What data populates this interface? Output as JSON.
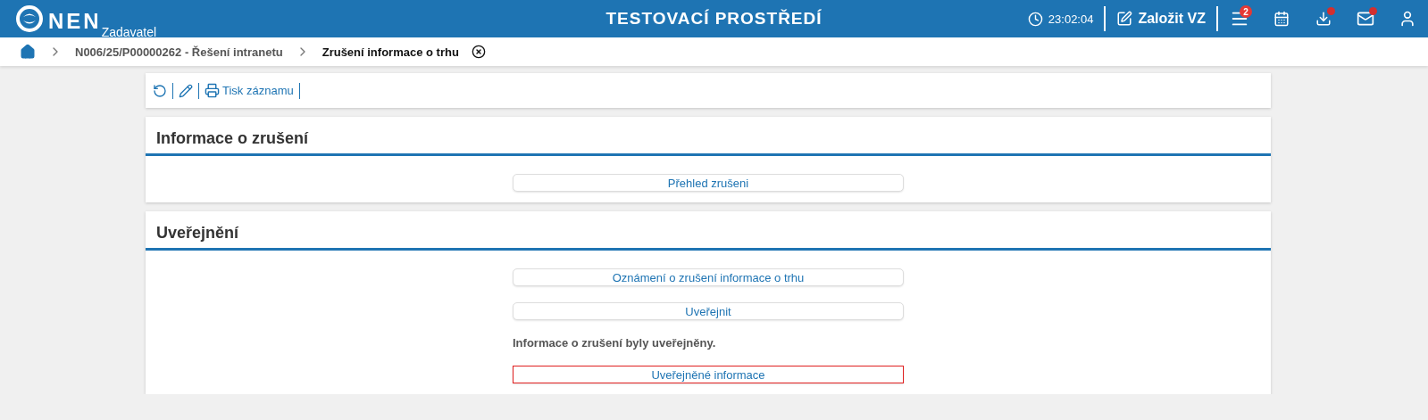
{
  "header": {
    "logo": "NEN",
    "role": "Zadavatel",
    "environment": "TESTOVACÍ PROSTŘEDÍ",
    "time": "23:02:04",
    "create_button": "Založit VZ",
    "menu_badge": "2",
    "download_alert": true,
    "mail_alert": true
  },
  "breadcrumb": [
    "N006/25/P00000262 - Řešení intranetu",
    "Zrušení informace o trhu"
  ],
  "toolbar": {
    "print_label": "Tisk záznamu"
  },
  "sections": [
    {
      "title": "Informace o zrušení",
      "items": [
        {
          "kind": "button",
          "label": "Přehled zrušeni",
          "focused": false
        }
      ]
    },
    {
      "title": "Uveřejnění",
      "items": [
        {
          "kind": "button",
          "label": "Oznámení o zrušení informace o trhu",
          "focused": false
        },
        {
          "kind": "button",
          "label": "Uveřejnit",
          "focused": false
        },
        {
          "kind": "text",
          "label": "Informace o zrušení byly uveřejněny."
        },
        {
          "kind": "button",
          "label": "Uveřejněné informace",
          "focused": true
        }
      ]
    }
  ]
}
